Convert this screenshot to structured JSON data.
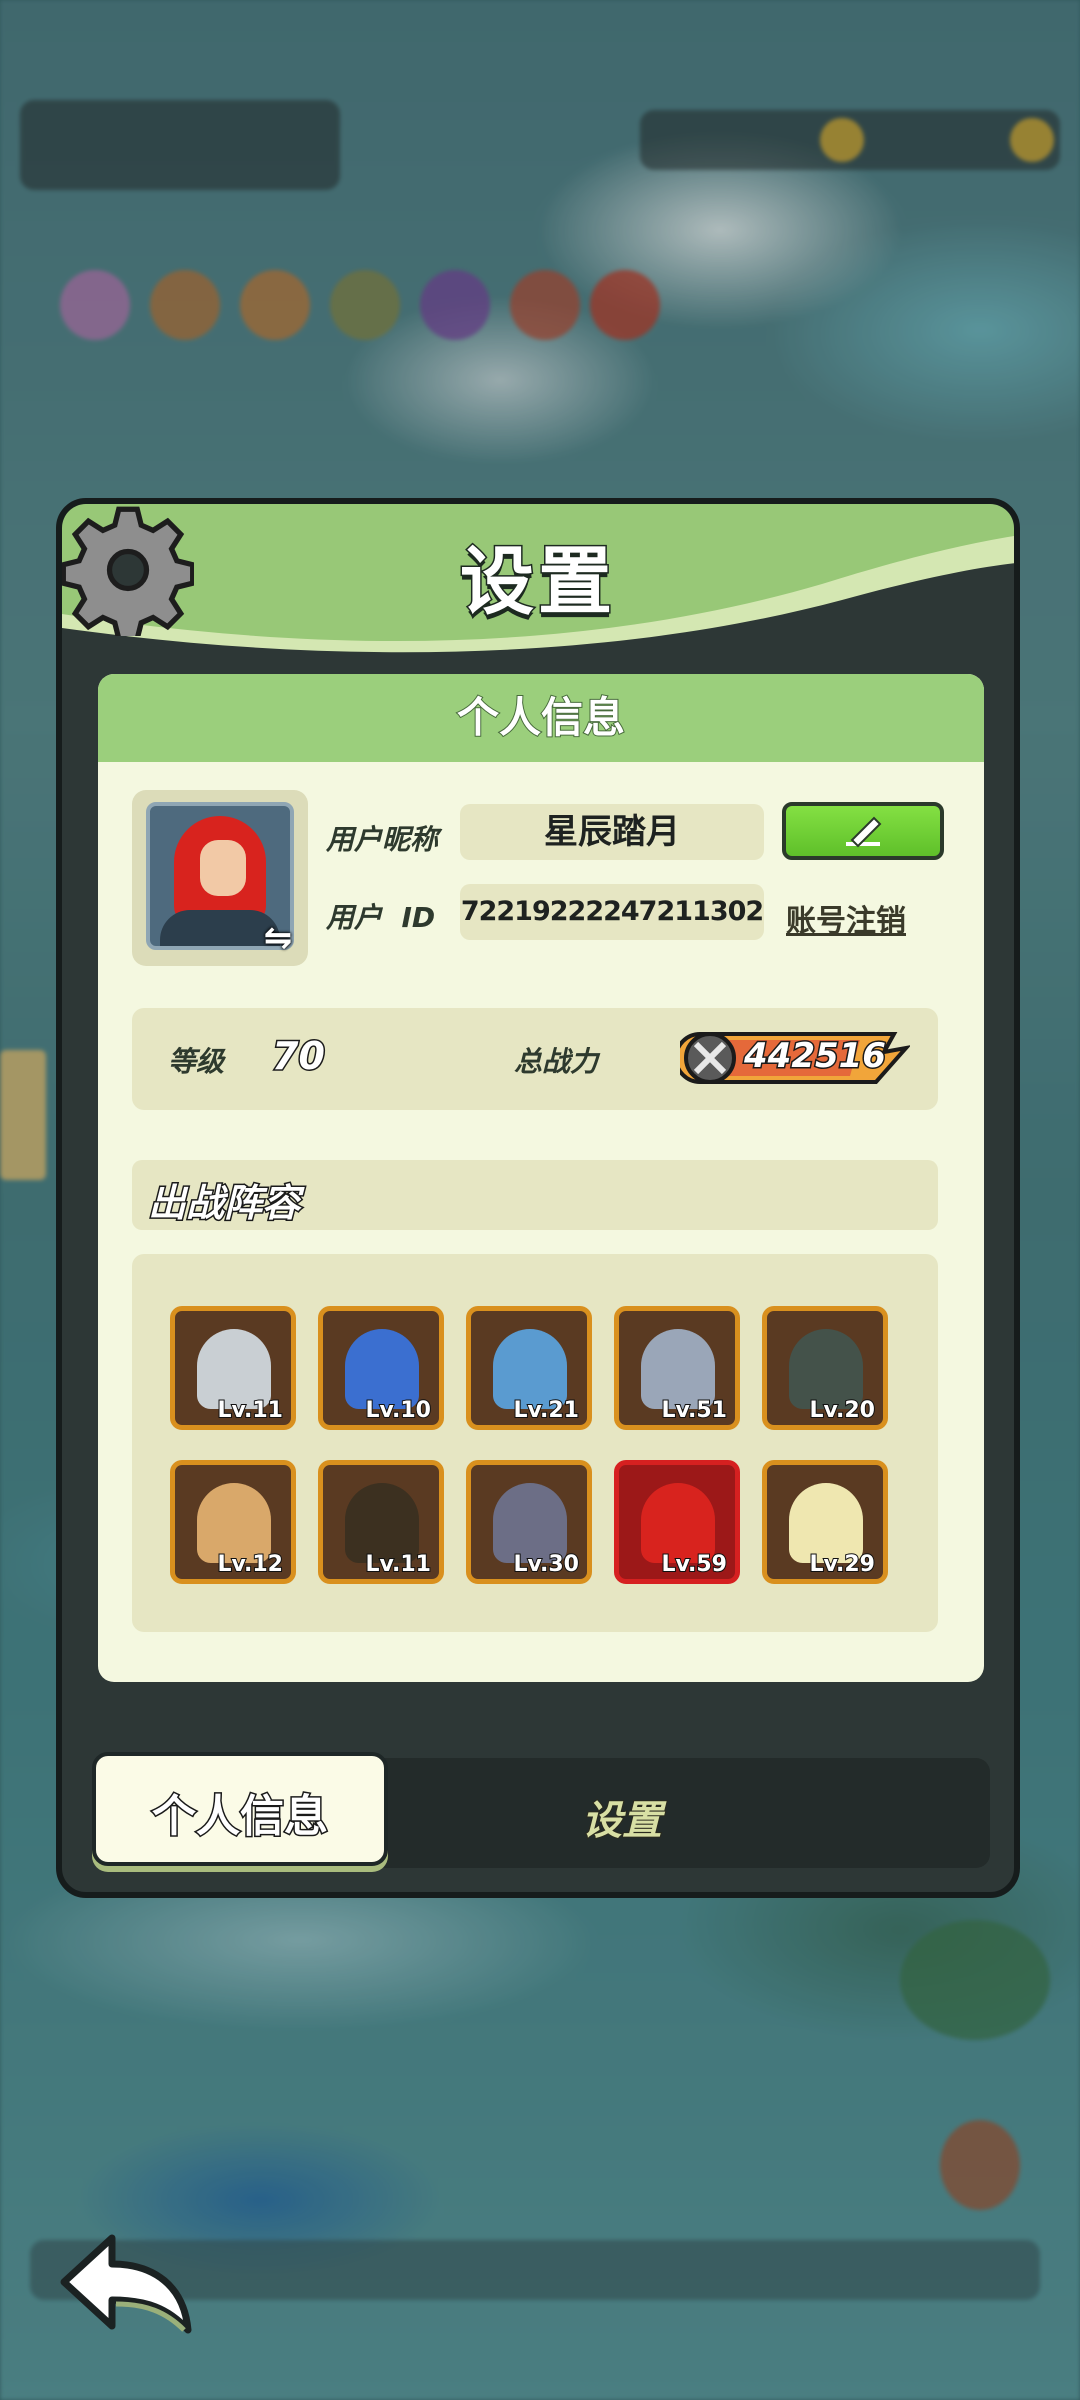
{
  "dialog": {
    "title": "设置",
    "section_title": "个人信息"
  },
  "profile": {
    "nickname_label": "用户昵称",
    "nickname": "星辰踏月",
    "id_label": "用户  ID",
    "user_id": "72219222247211302",
    "deregister_link": "账号注销",
    "level_label": "等级",
    "level": "70",
    "power_label": "总战力",
    "power": "442516"
  },
  "lineup": {
    "title": "出战阵容",
    "heroes": [
      {
        "level": "Lv.11",
        "color": "#c9cfd3"
      },
      {
        "level": "Lv.10",
        "color": "#3b6fd0"
      },
      {
        "level": "Lv.21",
        "color": "#5a9bd0"
      },
      {
        "level": "Lv.51",
        "color": "#9aa6b8"
      },
      {
        "level": "Lv.20",
        "color": "#44524a"
      },
      {
        "level": "Lv.12",
        "color": "#d9a86a"
      },
      {
        "level": "Lv.11",
        "color": "#3c3020"
      },
      {
        "level": "Lv.30",
        "color": "#6c6e86"
      },
      {
        "level": "Lv.59",
        "color": "#d8231e"
      },
      {
        "level": "Lv.29",
        "color": "#efe7b0"
      }
    ]
  },
  "tabs": [
    {
      "label": "个人信息",
      "active": true
    },
    {
      "label": "设置",
      "active": false
    }
  ],
  "icons": {
    "gear": "gear-icon",
    "edit": "pencil-icon",
    "swap": "swap-icon",
    "power": "crossed-swords-icon",
    "back": "back-arrow-icon"
  },
  "colors": {
    "header_green": "#98c877",
    "card_bg": "#f4f8e0",
    "edit_button": "#6bd033",
    "hero_frame": "#d9901e"
  }
}
